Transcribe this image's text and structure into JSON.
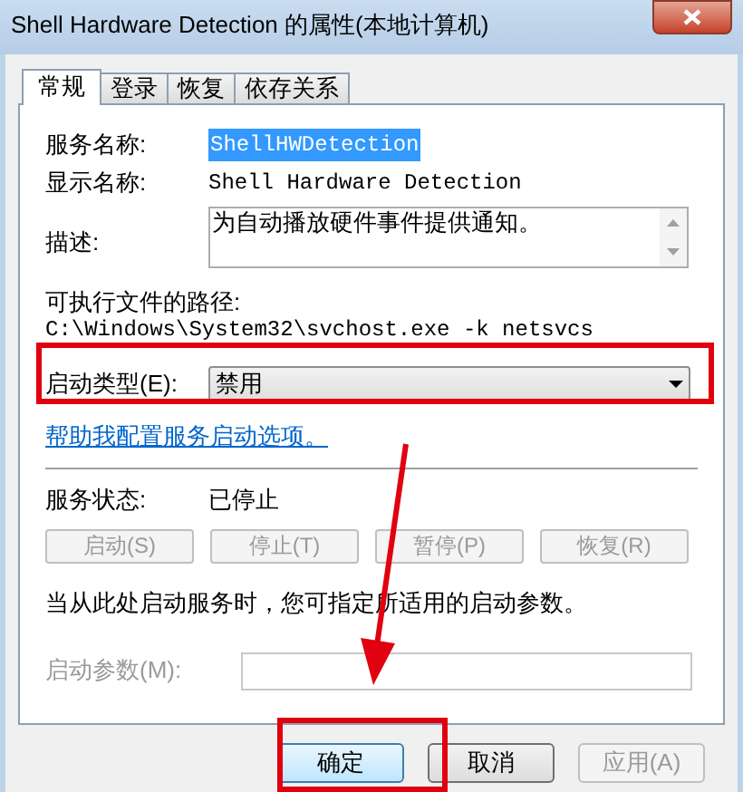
{
  "window": {
    "title": "Shell Hardware Detection 的属性(本地计算机)"
  },
  "tabs": [
    {
      "label": "常规",
      "selected": true
    },
    {
      "label": "登录",
      "selected": false
    },
    {
      "label": "恢复",
      "selected": false
    },
    {
      "label": "依存关系",
      "selected": false
    }
  ],
  "service_name": {
    "label": "服务名称:",
    "value": "ShellHWDetection",
    "selected": true
  },
  "display_name": {
    "label": "显示名称:",
    "value": "Shell Hardware Detection"
  },
  "description": {
    "label": "描述:",
    "value": "为自动播放硬件事件提供通知。"
  },
  "executable_path": {
    "label": "可执行文件的路径:",
    "value": "C:\\Windows\\System32\\svchost.exe -k netsvcs"
  },
  "startup_type": {
    "label": "启动类型(E):",
    "value": "禁用"
  },
  "help_link": "帮助我配置服务启动选项。",
  "service_status": {
    "label": "服务状态:",
    "value": "已停止"
  },
  "service_buttons": [
    {
      "label": "启动(S)",
      "disabled": true
    },
    {
      "label": "停止(T)",
      "disabled": true
    },
    {
      "label": "暂停(P)",
      "disabled": true
    },
    {
      "label": "恢复(R)",
      "disabled": true
    }
  ],
  "parameters_hint": "当从此处启动服务时，您可指定所适用的启动参数。",
  "start_parameters": {
    "label": "启动参数(M):",
    "disabled": true
  },
  "dialog_buttons": [
    {
      "label": "确定",
      "disabled": false,
      "default": true
    },
    {
      "label": "取消",
      "disabled": false,
      "default": false
    },
    {
      "label": "应用(A)",
      "disabled": true,
      "default": false
    }
  ],
  "annotations": [
    {
      "kind": "box"
    },
    {
      "kind": "arrow"
    },
    {
      "kind": "box"
    }
  ]
}
